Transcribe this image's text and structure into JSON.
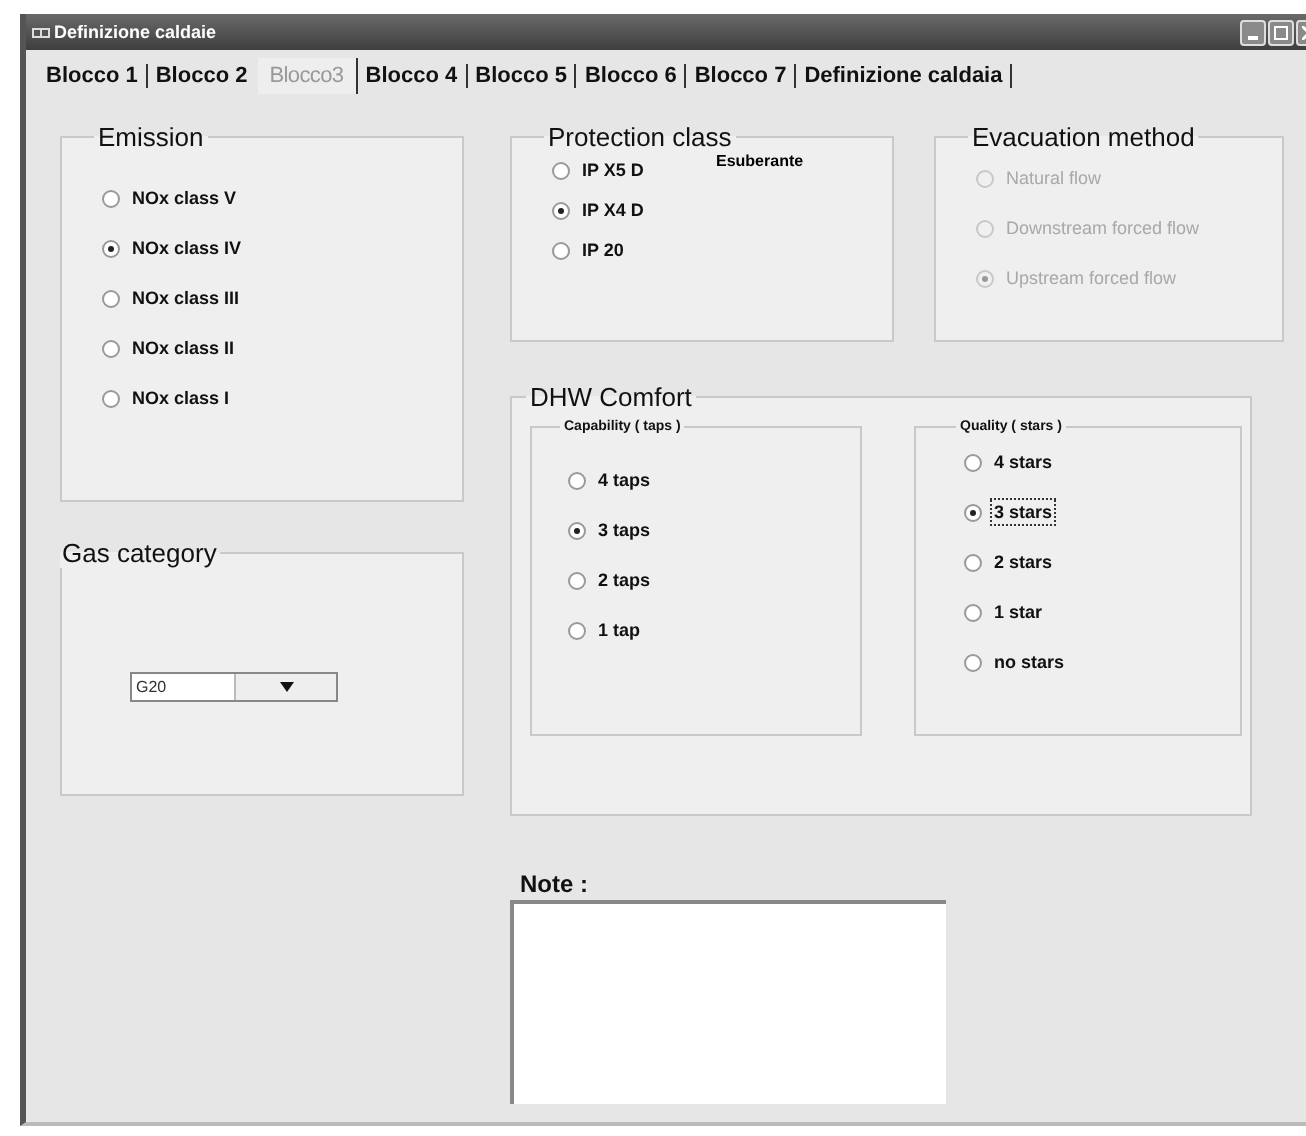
{
  "window": {
    "title": "Definizione caldaie"
  },
  "tabs": [
    {
      "label": "Blocco 1",
      "selected": false
    },
    {
      "label": "Blocco 2",
      "selected": false
    },
    {
      "label": "Blocco3",
      "selected": true
    },
    {
      "label": "Blocco 4",
      "selected": false
    },
    {
      "label": "Blocco 5",
      "selected": false
    },
    {
      "label": "Blocco 6",
      "selected": false
    },
    {
      "label": "Blocco 7",
      "selected": false
    },
    {
      "label": "Definizione caldaia",
      "selected": false
    }
  ],
  "emission": {
    "title": "Emission",
    "options": [
      {
        "label": "NOx class V",
        "selected": false
      },
      {
        "label": "NOx class IV",
        "selected": true
      },
      {
        "label": "NOx class III",
        "selected": false
      },
      {
        "label": "NOx class II",
        "selected": false
      },
      {
        "label": "NOx class I",
        "selected": false
      }
    ]
  },
  "gas_category": {
    "title": "Gas category",
    "value": "G20"
  },
  "protection_class": {
    "title": "Protection class",
    "remark": "Esuberante",
    "options": [
      {
        "label": "IP X5 D",
        "selected": false
      },
      {
        "label": "IP X4 D",
        "selected": true
      },
      {
        "label": "IP 20",
        "selected": false
      }
    ]
  },
  "evacuation_method": {
    "title": "Evacuation method",
    "disabled": true,
    "options": [
      {
        "label": "Natural flow",
        "selected": false
      },
      {
        "label": "Downstream forced flow",
        "selected": false
      },
      {
        "label": "Upstream forced flow",
        "selected": true
      }
    ]
  },
  "dhw_comfort": {
    "title": "DHW Comfort",
    "capability": {
      "title": "Capability ( taps )",
      "options": [
        {
          "label": "4 taps",
          "selected": false
        },
        {
          "label": "3 taps",
          "selected": true
        },
        {
          "label": "2 taps",
          "selected": false
        },
        {
          "label": "1 tap",
          "selected": false
        }
      ]
    },
    "quality": {
      "title": "Quality ( stars )",
      "options": [
        {
          "label": "4 stars",
          "selected": false,
          "focused": false
        },
        {
          "label": "3 stars",
          "selected": true,
          "focused": true
        },
        {
          "label": "2 stars",
          "selected": false,
          "focused": false
        },
        {
          "label": "1 star",
          "selected": false,
          "focused": false
        },
        {
          "label": "no stars",
          "selected": false,
          "focused": false
        }
      ]
    }
  },
  "note": {
    "label": "Note :"
  }
}
